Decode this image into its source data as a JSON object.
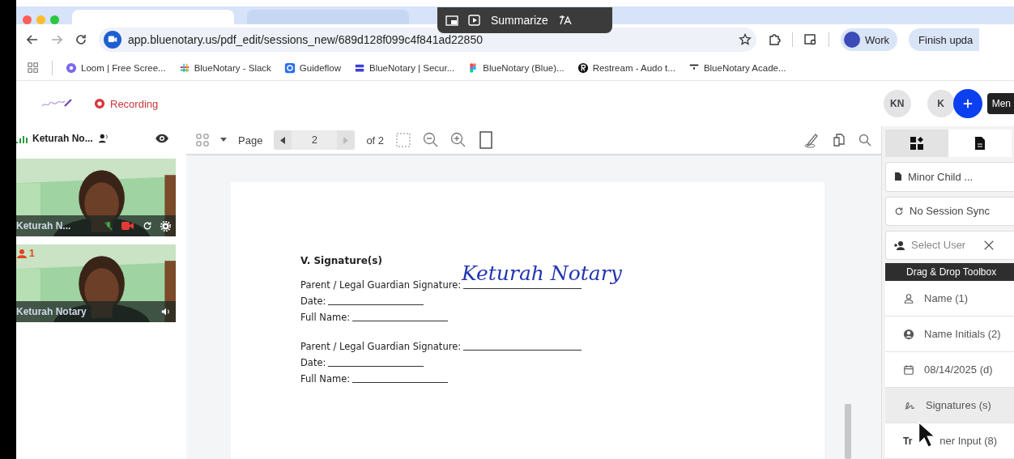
{
  "overlay": {
    "label": "Summarize"
  },
  "address_bar": {
    "url": "app.bluenotary.us/pdf_edit/sessions_new/689d128f099c4f841ad22850"
  },
  "profile": {
    "label": "Work"
  },
  "update_button": {
    "label": "Finish upda"
  },
  "bookmarks": [
    {
      "kind": "loom",
      "label": "Loom | Free Scree..."
    },
    {
      "kind": "slack",
      "label": "BlueNotary - Slack"
    },
    {
      "kind": "guideflow",
      "label": "Guideflow"
    },
    {
      "kind": "bluenotary",
      "label": "BlueNotary | Secur..."
    },
    {
      "kind": "figma",
      "label": "BlueNotary (Blue)..."
    },
    {
      "kind": "restream",
      "label": "Restream - Audo t..."
    },
    {
      "kind": "academy",
      "label": "BlueNotary Acade..."
    }
  ],
  "app_header": {
    "recording": "Recording",
    "avatars": [
      {
        "initials": "KN"
      },
      {
        "initials": "K"
      }
    ],
    "menu_tooltip": "Men"
  },
  "participants": {
    "header_name": "Keturah No...",
    "tiles": [
      {
        "kind": "local",
        "name": "Keturah N..."
      },
      {
        "kind": "remote",
        "name": "Keturah Notary",
        "count": "1"
      }
    ]
  },
  "viewer_toolbar": {
    "page_label": "Page",
    "page": "2",
    "of_label": "of 2"
  },
  "document": {
    "heading": "V. Signature(s)",
    "signature": "Keturah Notary",
    "groups": [
      {
        "fields": [
          {
            "kind": "long",
            "label": "Parent / Legal Guardian Signature:"
          },
          {
            "kind": "short",
            "label": "Date:"
          },
          {
            "kind": "short",
            "label": "Full Name:"
          }
        ]
      },
      {
        "fields": [
          {
            "kind": "long",
            "label": "Parent / Legal Guardian Signature:"
          },
          {
            "kind": "short",
            "label": "Date:"
          },
          {
            "kind": "short",
            "label": "Full Name:"
          }
        ]
      }
    ]
  },
  "side_panel": {
    "tabs": [
      {
        "kind": "widgets",
        "selected": true
      },
      {
        "kind": "document",
        "selected": false
      }
    ],
    "document_select": "Minor Child ...",
    "sync_select": "No Session Sync",
    "user_select": {
      "placeholder": "Select User"
    },
    "toolbox_title": "Drag & Drop Toolbox",
    "tools": [
      {
        "kind": "name",
        "label": "Name (1)",
        "selected": false
      },
      {
        "kind": "initials",
        "label": "Name Initials (2)",
        "selected": false
      },
      {
        "kind": "date",
        "label": "08/14/2025 (d)",
        "selected": false
      },
      {
        "kind": "signature",
        "label": "Signatures (s)",
        "selected": true
      },
      {
        "kind": "text",
        "icon_text": "Tr",
        "label": "ner Input (8)",
        "selected": false
      }
    ]
  }
}
